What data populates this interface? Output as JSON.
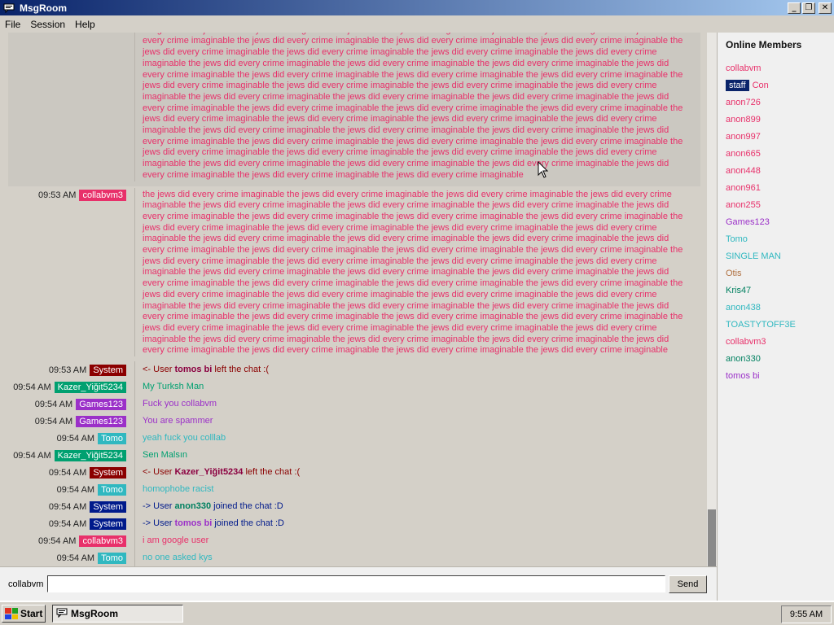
{
  "window": {
    "title": "MsgRoom"
  },
  "menu": [
    "File",
    "Session",
    "Help"
  ],
  "colors": {
    "collabvm3": "#e8306a",
    "System": "#8b0000",
    "System2": "#001a8b",
    "Kazer": "#00a070",
    "Games123": "#9b30c8",
    "Tomo": "#30b8c0"
  },
  "messages": [
    {
      "time": "09:53 AM",
      "user": "collabvm3",
      "color": "#e8306a",
      "text_color": "#e8306a",
      "highlight": true,
      "text": "the jews did every crime imaginable the jews did every crime imaginable the jews did every crime imaginable the jews did every crime imaginable the jews did every crime imaginable the jews did every crime imaginable the jews did every crime imaginable the jews did every crime imaginable the jews did every crime imaginable the jews did every crime imaginable the jews did every crime imaginable the jews did every crime imaginable the jews did every crime imaginable the jews did every crime imaginable the jews did every crime imaginable the jews did every crime imaginable the jews did every crime imaginable the jews did every crime imaginable the jews did every crime imaginable the jews did every crime imaginable the jews did every crime imaginable the jews did every crime imaginable the jews did every crime imaginable the jews did every crime imaginable the jews did every crime imaginable the jews did every crime imaginable the jews did every crime imaginable the jews did every crime imaginable the jews did every crime imaginable the jews did every crime imaginable the jews did every crime imaginable the jews did every crime imaginable the jews did every crime imaginable the jews did every crime imaginable the jews did every crime imaginable the jews did every crime imaginable the jews did every crime imaginable the jews did every crime imaginable the jews did every crime imaginable the jews did every crime imaginable the jews did every crime imaginable the jews did every crime imaginable the jews did every crime imaginable the jews did every crime imaginable the jews did every crime imaginable the jews did every crime imaginable the jews did every crime imaginable the jews did every crime imaginable the jews did every crime imaginable the jews did every crime imaginable the jews did every crime imaginable the jews did every crime imaginable the jews did every crime imaginable the jews did every crime imaginable"
    },
    {
      "time": "09:53 AM",
      "user": "collabvm3",
      "color": "#e8306a",
      "text_color": "#e8306a",
      "highlight": false,
      "text": "the jews did every crime imaginable the jews did every crime imaginable the jews did every crime imaginable the jews did every crime imaginable the jews did every crime imaginable the jews did every crime imaginable the jews did every crime imaginable the jews did every crime imaginable the jews did every crime imaginable the jews did every crime imaginable the jews did every crime imaginable the jews did every crime imaginable the jews did every crime imaginable the jews did every crime imaginable the jews did every crime imaginable the jews did every crime imaginable the jews did every crime imaginable the jews did every crime imaginable the jews did every crime imaginable the jews did every crime imaginable the jews did every crime imaginable the jews did every crime imaginable the jews did every crime imaginable the jews did every crime imaginable the jews did every crime imaginable the jews did every crime imaginable the jews did every crime imaginable the jews did every crime imaginable the jews did every crime imaginable the jews did every crime imaginable the jews did every crime imaginable the jews did every crime imaginable the jews did every crime imaginable the jews did every crime imaginable the jews did every crime imaginable the jews did every crime imaginable the jews did every crime imaginable the jews did every crime imaginable the jews did every crime imaginable the jews did every crime imaginable the jews did every crime imaginable the jews did every crime imaginable the jews did every crime imaginable the jews did every crime imaginable the jews did every crime imaginable the jews did every crime imaginable the jews did every crime imaginable the jews did every crime imaginable the jews did every crime imaginable the jews did every crime imaginable the jews did every crime imaginable the jews did every crime imaginable the jews did every crime imaginable the jews did every crime imaginable the jews did every crime imaginable"
    },
    {
      "time": "09:53 AM",
      "user": "System",
      "color": "#8b0000",
      "text_color": "#8b0000",
      "prefix": "<- User ",
      "name": "tomos bi",
      "suffix": " left the chat :(",
      "name_color": "#8b0040"
    },
    {
      "time": "09:54 AM",
      "user": "Kazer_Yiğit5234",
      "color": "#00a070",
      "text_color": "#00a070",
      "text": "My Turksh Man"
    },
    {
      "time": "09:54 AM",
      "user": "Games123",
      "color": "#9b30c8",
      "text_color": "#9b30c8",
      "text": "Fuck you collabvm"
    },
    {
      "time": "09:54 AM",
      "user": "Games123",
      "color": "#9b30c8",
      "text_color": "#9b30c8",
      "text": "You are spammer"
    },
    {
      "time": "09:54 AM",
      "user": "Tomo",
      "color": "#30b8c0",
      "text_color": "#30b8c0",
      "text": "yeah fuck you colllab"
    },
    {
      "time": "09:54 AM",
      "user": "Kazer_Yiğit5234",
      "color": "#00a070",
      "text_color": "#00a070",
      "text": "Sen Malsın"
    },
    {
      "time": "09:54 AM",
      "user": "System",
      "color": "#8b0000",
      "text_color": "#8b0000",
      "prefix": "<- User ",
      "name": "Kazer_Yiğit5234",
      "suffix": " left the chat :(",
      "name_color": "#8b0040"
    },
    {
      "time": "09:54 AM",
      "user": "Tomo",
      "color": "#30b8c0",
      "text_color": "#30b8c0",
      "text": "homophobe racist"
    },
    {
      "time": "09:54 AM",
      "user": "System",
      "color": "#001a8b",
      "text_color": "#001a8b",
      "prefix": "-> User ",
      "name": "anon330",
      "suffix": " joined the chat :D",
      "name_color": "#008060"
    },
    {
      "time": "09:54 AM",
      "user": "System",
      "color": "#001a8b",
      "text_color": "#001a8b",
      "prefix": "-> User ",
      "name": "tomos bi",
      "suffix": " joined the chat :D",
      "name_color": "#9b30c8"
    },
    {
      "time": "09:54 AM",
      "user": "collabvm3",
      "color": "#e8306a",
      "text_color": "#e8306a",
      "text": "i am google user"
    },
    {
      "time": "09:54 AM",
      "user": "Tomo",
      "color": "#30b8c0",
      "text_color": "#30b8c0",
      "text": "no one asked kys"
    }
  ],
  "sidebar": {
    "title": "Online Members",
    "members": [
      {
        "name": "collabvm",
        "color": "#e8306a"
      },
      {
        "name": "Con",
        "color": "#e8306a",
        "staff": "staff"
      },
      {
        "name": "anon726",
        "color": "#e8306a"
      },
      {
        "name": "anon899",
        "color": "#e8306a"
      },
      {
        "name": "anon997",
        "color": "#e8306a"
      },
      {
        "name": "anon665",
        "color": "#e8306a"
      },
      {
        "name": "anon448",
        "color": "#e8306a"
      },
      {
        "name": "anon961",
        "color": "#e8306a"
      },
      {
        "name": "anon255",
        "color": "#e8306a"
      },
      {
        "name": "Games123",
        "color": "#9b30c8"
      },
      {
        "name": "Tomo",
        "color": "#30b8c0"
      },
      {
        "name": "SINGLE MAN",
        "color": "#30b8c0"
      },
      {
        "name": "Otis",
        "color": "#b07040"
      },
      {
        "name": "Kris47",
        "color": "#008060"
      },
      {
        "name": "anon438",
        "color": "#30b8c0"
      },
      {
        "name": "TOASTYTOFF3E",
        "color": "#30b8c0"
      },
      {
        "name": "collabvm3",
        "color": "#e8306a"
      },
      {
        "name": "anon330",
        "color": "#008060"
      },
      {
        "name": "tomos bi",
        "color": "#9b30c8"
      }
    ]
  },
  "input": {
    "username": "collabvm",
    "value": "",
    "send_label": "Send"
  },
  "taskbar": {
    "start_label": "Start",
    "task_label": "MsgRoom",
    "clock": "9:55 AM"
  }
}
